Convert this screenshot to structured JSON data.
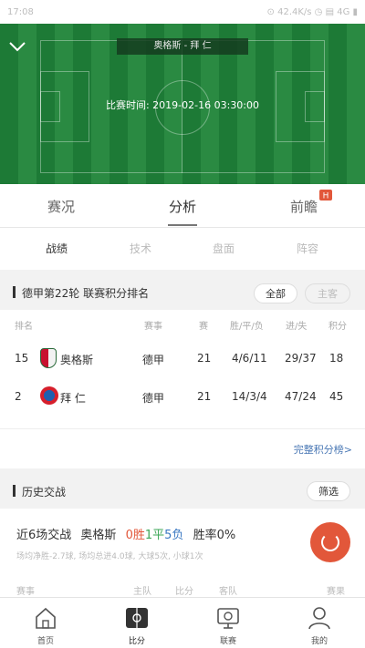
{
  "status_bar": {
    "time": "17:08",
    "indicators": "⊙ 42.4K/s ◷ ▤ 4G ▮"
  },
  "match": {
    "teams": "奥格斯 - 拜 仁",
    "time_label": "比赛时间: 2019-02-16 03:30:00"
  },
  "main_tabs": [
    {
      "label": "赛况"
    },
    {
      "label": "分析"
    },
    {
      "label": "前瞻"
    }
  ],
  "sub_tabs": [
    {
      "label": "战绩"
    },
    {
      "label": "技术"
    },
    {
      "label": "盘面"
    },
    {
      "label": "阵容"
    }
  ],
  "standings": {
    "title": "德甲第22轮 联赛积分排名",
    "filter_all": "全部",
    "filter_home_away": "主客",
    "headers": {
      "rank": "排名",
      "league": "赛事",
      "played": "赛",
      "wdl": "胜/平/负",
      "goals": "进/失",
      "points": "积分"
    },
    "rows": [
      {
        "rank": "15",
        "team": "奥格斯",
        "league": "德甲",
        "played": "21",
        "wdl": "4/6/11",
        "goals": "29/37",
        "points": "18"
      },
      {
        "rank": "2",
        "team": "拜 仁",
        "league": "德甲",
        "played": "21",
        "wdl": "14/3/4",
        "goals": "47/24",
        "points": "45"
      }
    ],
    "full_link": "完整积分榜>"
  },
  "h2h": {
    "title": "历史交战",
    "filter": "筛选",
    "summary_prefix": "近6场交战",
    "team": "奥格斯",
    "wins": "0胜",
    "draws": "1平",
    "losses": "5负",
    "win_rate": "胜率0%",
    "sub": "场均净胜-2.7球, 场均总进4.0球, 大球5次, 小球1次",
    "col_headers": {
      "league": "赛事",
      "home": "主队",
      "score": "比分",
      "away": "客队",
      "result": "赛果"
    }
  },
  "bottom_nav": [
    {
      "label": "首页",
      "icon": "home-icon"
    },
    {
      "label": "比分",
      "icon": "scoreboard-icon"
    },
    {
      "label": "联赛",
      "icon": "league-icon"
    },
    {
      "label": "我的",
      "icon": "profile-icon"
    }
  ],
  "colors": {
    "field_green": "#1d7a36",
    "accent_red": "#e2573a",
    "win_red": "#e2573a",
    "draw_green": "#3aa655",
    "loss_blue": "#3a78c2",
    "link_blue": "#4a78b5"
  }
}
